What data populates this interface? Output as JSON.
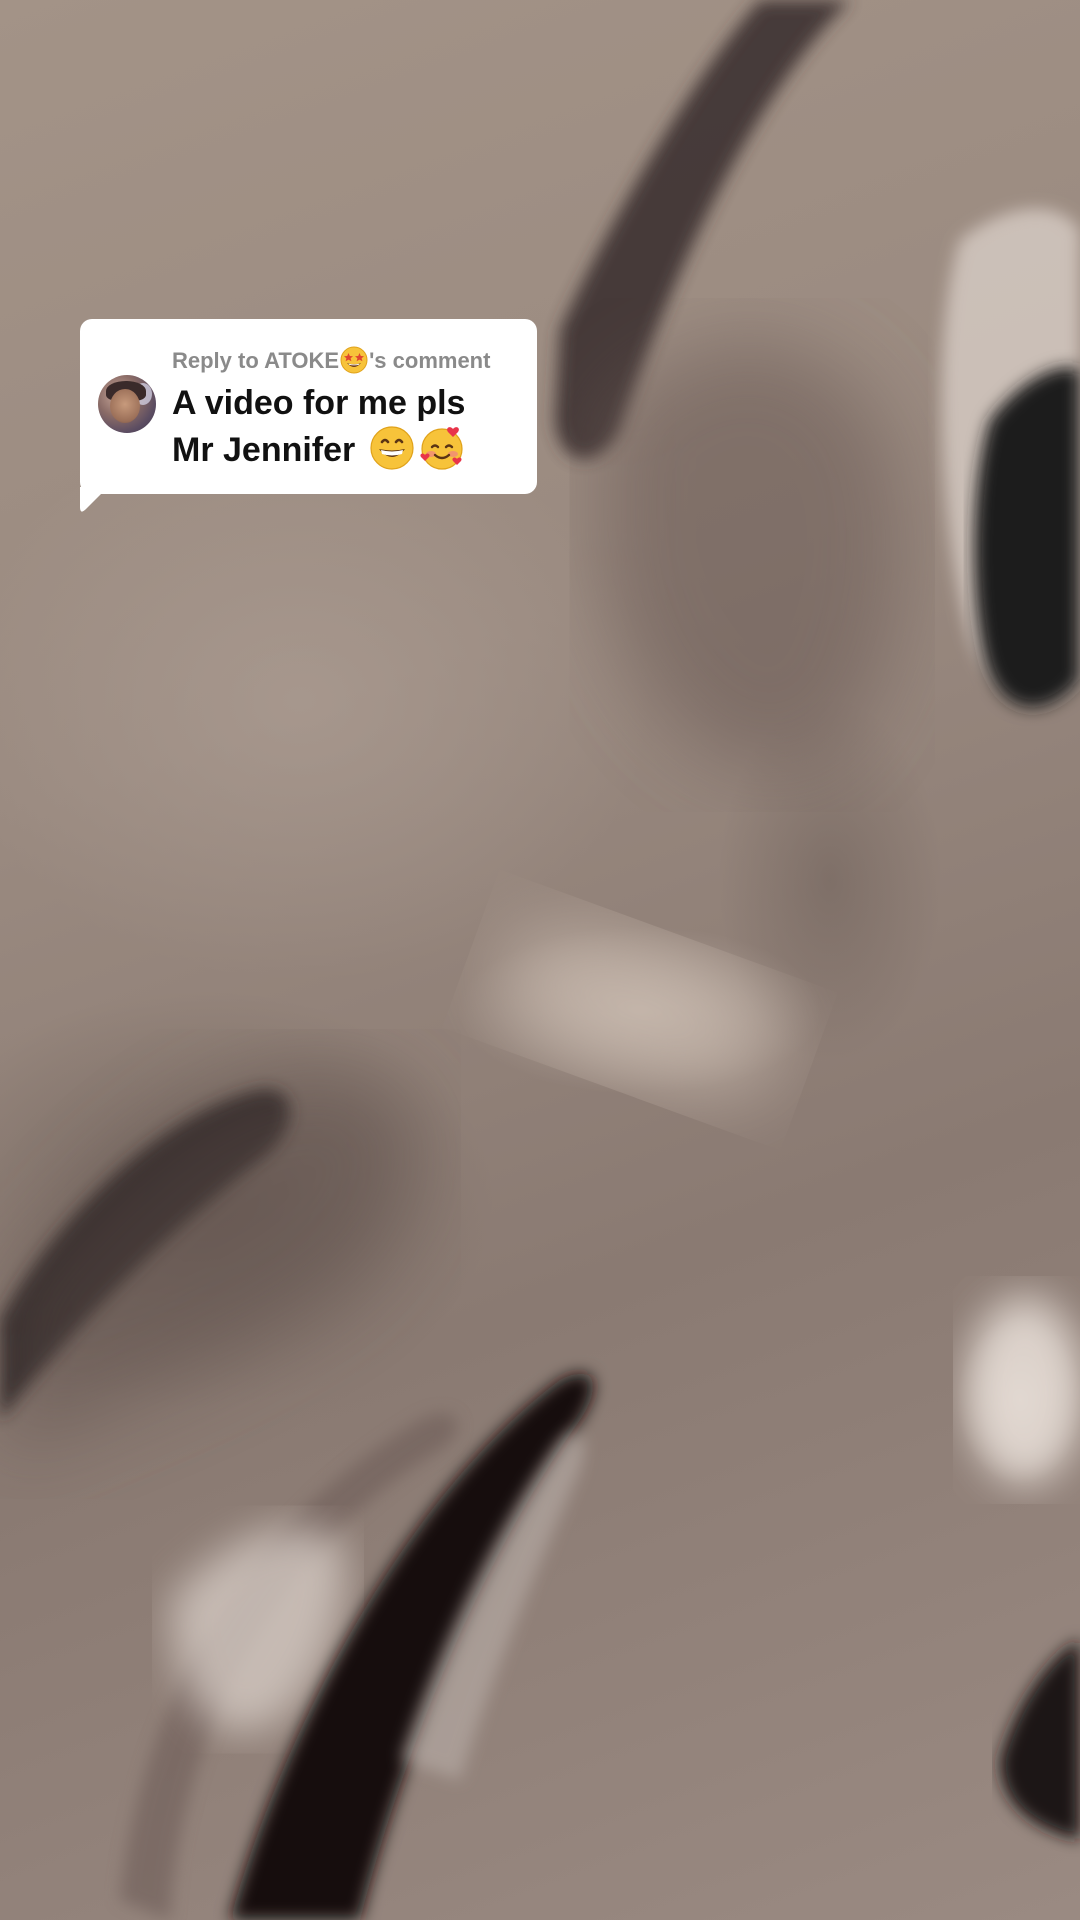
{
  "reply_sticker": {
    "prefix": "Reply to ATOKE",
    "suffix": "'s comment",
    "prefix_emoji_icon": "star-struck-emoji-icon",
    "comment_line_1": "A video for me pls",
    "comment_line_2": "Mr Jennifer",
    "comment_emoji_icons": [
      "grinning-face-emoji-icon",
      "smiling-face-with-hearts-emoji-icon"
    ]
  },
  "colors": {
    "card_background": "#ffffff",
    "header_text": "#8a8a8a",
    "comment_text": "#111111"
  }
}
